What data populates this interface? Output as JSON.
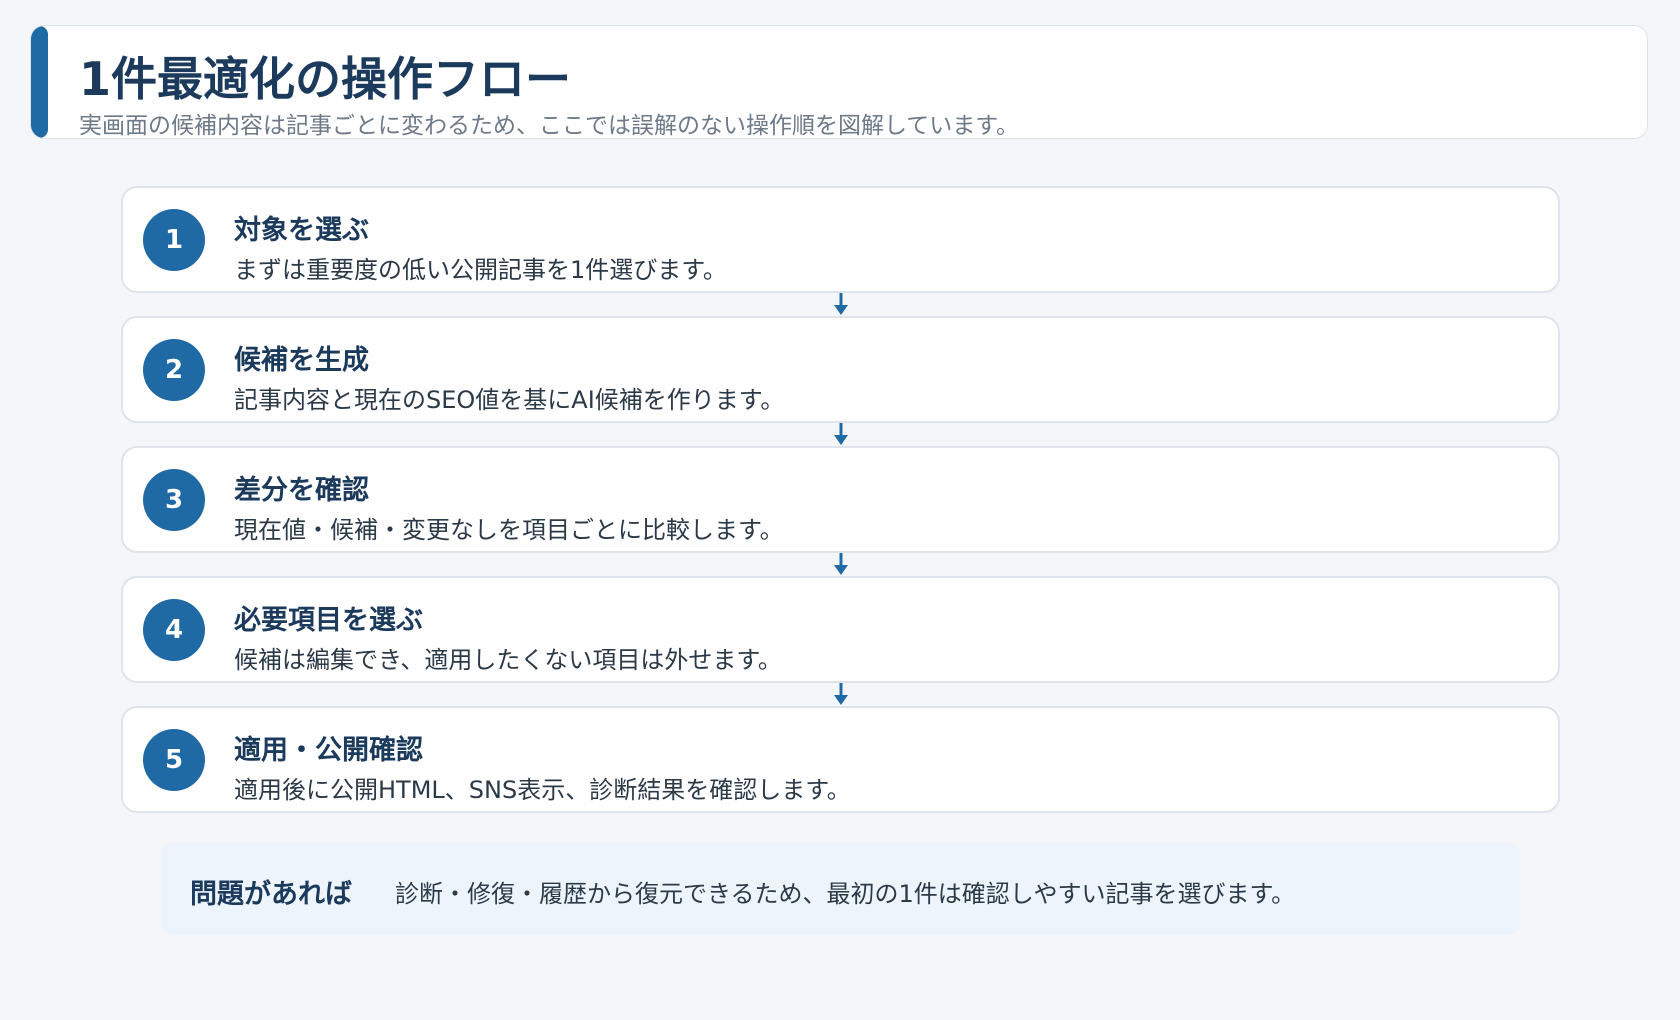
{
  "header": {
    "title": "1件最適化の操作フロー",
    "subtitle": "実画面の候補内容は記事ごとに変わるため、ここでは誤解のない操作順を図解しています。"
  },
  "steps": [
    {
      "num": "1",
      "title": "対象を選ぶ",
      "desc": "まずは重要度の低い公開記事を1件選びます。"
    },
    {
      "num": "2",
      "title": "候補を生成",
      "desc": "記事内容と現在のSEO値を基にAI候補を作ります。"
    },
    {
      "num": "3",
      "title": "差分を確認",
      "desc": "現在値・候補・変更なしを項目ごとに比較します。"
    },
    {
      "num": "4",
      "title": "必要項目を選ぶ",
      "desc": "候補は編集でき、適用したくない項目は外せます。"
    },
    {
      "num": "5",
      "title": "適用・公開確認",
      "desc": "適用後に公開HTML、SNS表示、診断結果を確認します。"
    }
  ],
  "note": {
    "label": "問題があれば",
    "text": "診断・修復・履歴から復元できるため、最初の1件は確認しやすい記事を選びます。"
  },
  "colors": {
    "accent": "#1f6aa5",
    "title": "#1b3a5c",
    "note_bg": "#edf4fb"
  }
}
